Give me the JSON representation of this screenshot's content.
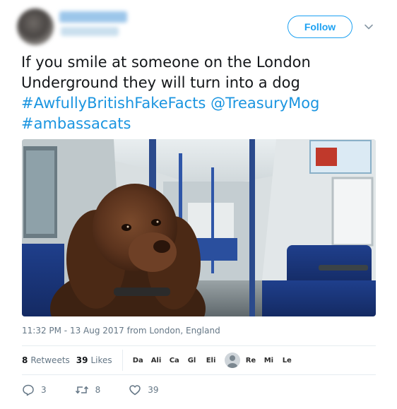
{
  "header": {
    "follow_label": "Follow"
  },
  "tweet": {
    "text_line1": "If you smile at someone on the London",
    "text_line2": "Underground they will turn into a dog",
    "hashtag1": "#AwfullyBritishFakeFacts",
    "mention": "@TreasuryMog",
    "hashtag2": "#ambassacats"
  },
  "timestamp": "11:32 PM - 13 Aug 2017 from London, England",
  "stats": {
    "retweets_count": "8",
    "retweets_label": "Retweets",
    "likes_count": "39",
    "likes_label": "Likes",
    "likers": [
      "Da",
      "Ali",
      "Ca",
      "Gl",
      "Eli",
      "Re",
      "Mi",
      "Le"
    ]
  },
  "actions": {
    "replies": "3",
    "retweets": "8",
    "likes": "39"
  },
  "colors": {
    "accent": "#1da1f2",
    "link": "#1b95e0",
    "muted": "#657786"
  },
  "icons": {
    "reply": "reply-icon",
    "retweet": "retweet-icon",
    "like": "heart-icon",
    "caret": "chevron-down-icon"
  }
}
